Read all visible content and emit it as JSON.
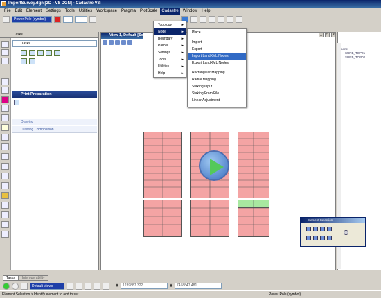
{
  "window": {
    "title": "ImportSurvey.dgn [2D - V8 DGN] - Cadastre V8i"
  },
  "menubar": [
    "File",
    "Edit",
    "Element",
    "Settings",
    "Tools",
    "Utilities",
    "Workspace",
    "Pragma",
    "PlotScale",
    "Cadastre",
    "Window",
    "Help"
  ],
  "toolbar": {
    "level_combo": "Power Pole (symbol)"
  },
  "tasks_panel": {
    "header": "Tasks",
    "select": "Tasks",
    "print_prep": "Print Preparation",
    "rows": [
      "Drawing",
      "Drawing Composition"
    ]
  },
  "view": {
    "title": "View 1, Default [Software"
  },
  "cadastre_menu": {
    "items": [
      {
        "label": "Topology",
        "arrow": "▸"
      },
      {
        "label": "Node",
        "arrow": "▸",
        "highlight": true
      },
      {
        "label": "Boundary",
        "arrow": "▸"
      },
      {
        "label": "Parcel",
        "arrow": "▸"
      },
      {
        "label": "Settings",
        "arrow": "▸"
      },
      {
        "label": "Tools",
        "arrow": "▸"
      },
      {
        "label": "Utilities",
        "arrow": "▸"
      },
      {
        "label": "Help",
        "arrow": "▸"
      }
    ]
  },
  "node_menu": {
    "items": [
      "Place",
      "Import",
      "Export",
      "Import LandXML Nodes",
      "Export LandXML Nodes",
      "Rectangular Mapping",
      "Radial Mapping",
      "Staking Input",
      "Staking From File",
      "Linear Adjustment"
    ]
  },
  "right_panel": {
    "tree": [
      "none",
      "SURB_TOP01",
      "SURB_TOP02"
    ]
  },
  "element_selection": {
    "title": "Element Selection"
  },
  "bottom_tabs": [
    "Tasks",
    "Interoperability"
  ],
  "bottom_toolbar": {
    "views": "Default Views",
    "x_label": "X",
    "x_value": "1239887.322",
    "y_label": "Y",
    "y_value": "7458847.481"
  },
  "status": {
    "left": "Element Selection > Identify element to add to set",
    "right": "Power Pole (symbol)"
  },
  "colors": {
    "parcel_fill": "#f4a4a4",
    "highlight_parcel": "#a8e8a0",
    "title_blue": "#0a246a"
  }
}
